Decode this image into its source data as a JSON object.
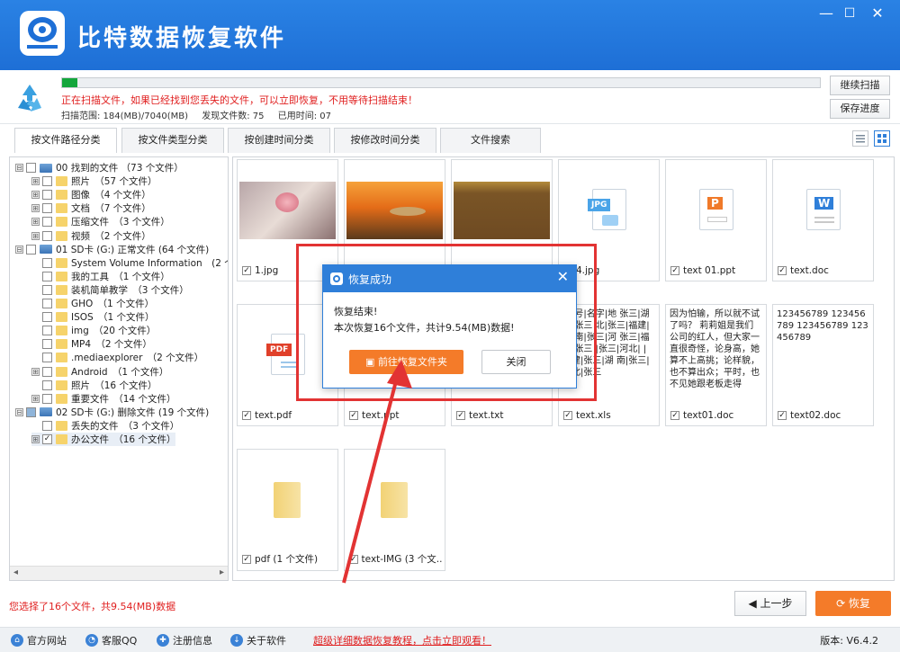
{
  "app": {
    "title": "比特数据恢复软件",
    "min": "—",
    "max": "☐",
    "close": "✕"
  },
  "scan": {
    "progress": 0.02,
    "message": "正在扫描文件，如果已经找到您丢失的文件，可以立即恢复，不用等待扫描结束！",
    "range": "扫描范围: 184(MB)/7040(MB)",
    "found": "发现文件数: 75",
    "time": "已用时间: 07",
    "continue": "继续扫描",
    "save": "保存进度"
  },
  "tabs": [
    "按文件路径分类",
    "按文件类型分类",
    "按创建时间分类",
    "按修改时间分类",
    "文件搜索"
  ],
  "tree": [
    {
      "level": 0,
      "exp": "⊟",
      "type": "drive",
      "text": "00 找到的文件 （73 个文件）"
    },
    {
      "level": 1,
      "exp": "⊞",
      "type": "folder",
      "text": "照片　（57 个文件）"
    },
    {
      "level": 1,
      "exp": "⊞",
      "type": "folder",
      "text": "图像　（4 个文件）"
    },
    {
      "level": 1,
      "exp": "⊞",
      "type": "folder",
      "text": "文档　（7 个文件）"
    },
    {
      "level": 1,
      "exp": "⊞",
      "type": "folder",
      "text": "压缩文件　（3 个文件）"
    },
    {
      "level": 1,
      "exp": "⊞",
      "type": "folder",
      "text": "视频　（2 个文件）"
    },
    {
      "level": 0,
      "exp": "⊟",
      "type": "drive",
      "text": "01 SD卡 (G:) 正常文件 (64 个文件)"
    },
    {
      "level": 1,
      "exp": "",
      "type": "folder",
      "text": "System Volume Information　(2 个文"
    },
    {
      "level": 1,
      "exp": "",
      "type": "folder",
      "text": "我的工具　（1 个文件）"
    },
    {
      "level": 1,
      "exp": "",
      "type": "folder",
      "text": "装机简单教学　（3 个文件）"
    },
    {
      "level": 1,
      "exp": "",
      "type": "folder",
      "text": "GHO　（1 个文件）"
    },
    {
      "level": 1,
      "exp": "",
      "type": "folder",
      "text": "ISOS　（1 个文件）"
    },
    {
      "level": 1,
      "exp": "",
      "type": "folder",
      "text": "img　（20 个文件）"
    },
    {
      "level": 1,
      "exp": "",
      "type": "folder",
      "text": "MP4　（2 个文件）"
    },
    {
      "level": 1,
      "exp": "",
      "type": "folder",
      "text": ".mediaexplorer　（2 个文件）"
    },
    {
      "level": 1,
      "exp": "⊞",
      "type": "folder",
      "text": "Android　（1 个文件）"
    },
    {
      "level": 1,
      "exp": "",
      "type": "folder",
      "text": "照片　（16 个文件）"
    },
    {
      "level": 1,
      "exp": "⊞",
      "type": "folder",
      "text": "重要文件　（14 个文件）"
    },
    {
      "level": 0,
      "exp": "⊟",
      "type": "drive",
      "text": "02 SD卡 (G:) 删除文件 (19 个文件)",
      "partial": true
    },
    {
      "level": 1,
      "exp": "",
      "type": "folder",
      "text": "丢失的文件　（3 个文件）"
    },
    {
      "level": 1,
      "exp": "⊞",
      "type": "folder",
      "text": "办公文件　（16 个文件）",
      "checked": true,
      "selected": true
    }
  ],
  "cards": [
    {
      "label": "1.jpg",
      "kind": "photo-rose"
    },
    {
      "label": "",
      "kind": "photo-sunset"
    },
    {
      "label": "",
      "kind": "photo-brown"
    },
    {
      "label": "4.jpg",
      "kind": "icon-jpg"
    },
    {
      "label": "text 01.ppt",
      "kind": "icon-ppt"
    },
    {
      "label": "text.doc",
      "kind": "icon-doc"
    },
    {
      "label": "text.pdf",
      "kind": "icon-pdf"
    },
    {
      "label": "text.ppt",
      "kind": "blank"
    },
    {
      "label": "text.txt",
      "kind": "blank"
    },
    {
      "label": "text.xls",
      "kind": "text",
      "preview": "|序号|名字|地 张三|湖南|张三 北|张三|福建| |湖南|张三|河 张三|福建|张三 |张三|河北| |福建|张三|湖 南|张三|河北|张三"
    },
    {
      "label": "text01.doc",
      "kind": "text",
      "preview": "因为怕输，所以就不试了吗？ 莉莉姐是我们公司的红人，但大家一直很奇怪，论身高，她算不上高挑；论样貌，也不算出众；平时，也不见她跟老板走得"
    },
    {
      "label": "text02.doc",
      "kind": "text",
      "preview": "123456789 123456789 123456789 123456789"
    },
    {
      "label": "pdf (1 个文件)",
      "kind": "folder"
    },
    {
      "label": "text-IMG (3 个文...",
      "kind": "folder"
    }
  ],
  "icons": {
    "jpg": "JPG",
    "ppt": "P",
    "doc": "W",
    "pdf": "PDF"
  },
  "dialog": {
    "title": "恢复成功",
    "line1": "恢复结束!",
    "line2": "本次恢复16个文件，共计9.54(MB)数据!",
    "go": "前往恢复文件夹",
    "close": "关闭"
  },
  "footer": {
    "selected": "您选择了16个文件，共9.54(MB)数据",
    "back": "◀ 上一步",
    "recover": "⟳ 恢复"
  },
  "status": {
    "site": "官方网站",
    "qq": "客服QQ",
    "reg": "注册信息",
    "about": "关于软件",
    "link": "超级详细数据恢复教程，点击立即观看！",
    "version": "版本: V6.4.2"
  },
  "colors": {
    "accent": "#1e6fd6",
    "recover": "#f47b29",
    "alert": "#e02020",
    "progress": "#14a63c"
  }
}
